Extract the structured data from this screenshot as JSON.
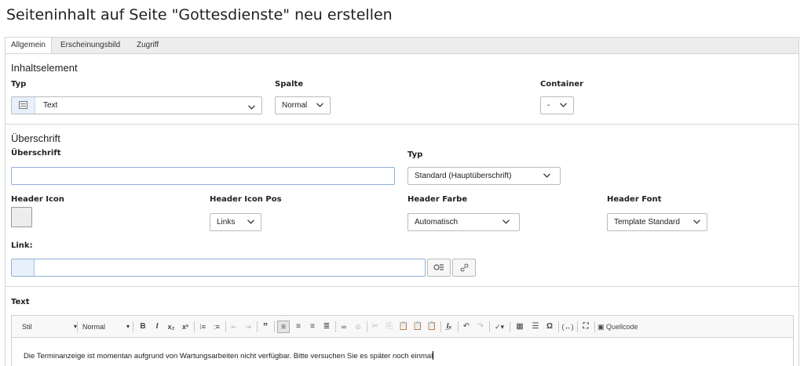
{
  "page": {
    "title": "Seiteninhalt auf Seite \"Gottesdienste\" neu erstellen"
  },
  "tabs": [
    {
      "label": "Allgemein",
      "active": true
    },
    {
      "label": "Erscheinungsbild",
      "active": false
    },
    {
      "label": "Zugriff",
      "active": false
    }
  ],
  "inhaltselement": {
    "section_title": "Inhaltselement",
    "typ": {
      "label": "Typ",
      "value": "Text",
      "icon": "document-icon"
    },
    "spalte": {
      "label": "Spalte",
      "value": "Normal"
    },
    "container": {
      "label": "Container",
      "value": "-"
    }
  },
  "ueberschrift": {
    "section_title": "Überschrift",
    "heading": {
      "label": "Überschrift",
      "value": ""
    },
    "typ": {
      "label": "Typ",
      "value": "Standard (Hauptüberschrift)"
    },
    "header_icon": {
      "label": "Header Icon"
    },
    "header_icon_pos": {
      "label": "Header Icon Pos",
      "value": "Links"
    },
    "header_farbe": {
      "label": "Header Farbe",
      "value": "Automatisch"
    },
    "header_font": {
      "label": "Header Font",
      "value": "Template Standard"
    },
    "link": {
      "label": "Link:",
      "value": ""
    }
  },
  "text_section": {
    "label": "Text",
    "toolbar": {
      "style_combo": "Stil",
      "format_combo": "Normal",
      "source_label": "Quellcode"
    },
    "content": "Die Terminanzeige ist momentan aufgrund von Wartungsarbeiten nicht verfügbar. Bitte versuchen Sie es später noch einmal"
  },
  "colors": {
    "input_focus_border": "#8fb0d8",
    "icon_prefix_bg": "#e8f0fb",
    "tabbar_bg": "#ededed"
  }
}
